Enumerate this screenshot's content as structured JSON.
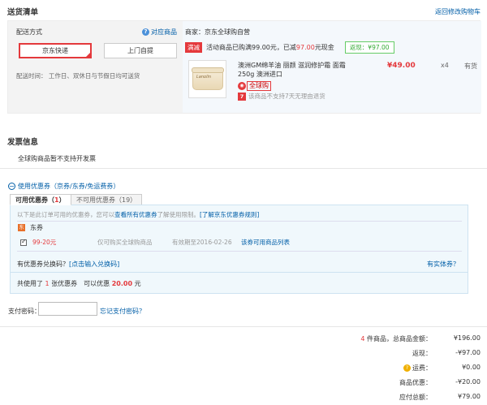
{
  "header": {
    "title": "送货清单",
    "back": "返回修改购物车"
  },
  "shipping": {
    "method_label": "配送方式",
    "match_goods": "对应商品",
    "options": [
      "京东快递",
      "上门自提"
    ],
    "time_label": "配送时间：",
    "time_value": "工作日、双休日与节假日均可送货"
  },
  "seller": {
    "name": "商家：京东全球购自营",
    "promo_tag": "满减",
    "promo_text_pre": "活动商品已购满99.00元，已减",
    "promo_amount": "97.00",
    "promo_text_post": "元现金",
    "rebate": "返现：¥97.00"
  },
  "product": {
    "image_text": "Lanolin",
    "name": "澳洲GM绵羊油 丽颜 滋润修护霜 面霜 250g 澳洲进口",
    "price": "¥49.00",
    "qty": "x4",
    "stock": "有货",
    "global_buy": "全球购",
    "no_return_icon": "7",
    "no_return": "该商品不支持7天无理由退货"
  },
  "invoice": {
    "title": "发票信息",
    "text": "全球购商品暂不支持开发票"
  },
  "coupon": {
    "toggle": "使用优惠券（京券/东券/免运费券）",
    "tab_available": "可用优惠券（",
    "tab_available_count": "1",
    "tab_available_close": "）",
    "tab_unavailable": "不可用优惠券（19）",
    "info_text": "以下是此订单可用的优惠券，您可以",
    "info_link1": "查看所有优惠券",
    "info_mid": "了解使用限制。",
    "info_link2": "[了解京东优惠券规则]",
    "group_icon": "东",
    "group": "东券",
    "item": {
      "amount": "99-20元",
      "scope": "仅可购买全球购商品",
      "expire": "有效期至2016-02-26",
      "list_link": "该券可用商品列表"
    },
    "redeem_text": "有优惠券兑换码？",
    "redeem_link": "[点击输入兑换码]",
    "physical": "有实体券？",
    "used_pre": "共使用了",
    "used_count": "1",
    "used_mid": "张优惠券　可以优惠",
    "used_amount": "20.00",
    "used_unit": "元"
  },
  "payment": {
    "label": "支付密码：",
    "forgot": "忘记支付密码？"
  },
  "summary": [
    {
      "count": "4",
      "label": "件商品，总商品金额：",
      "value": "¥196.00"
    },
    {
      "label": "返现：",
      "value": "-¥97.00"
    },
    {
      "label": "运费：",
      "value": "¥0.00",
      "icon": "?"
    },
    {
      "label": "商品优惠：",
      "value": "-¥20.00"
    },
    {
      "label": "应付总额：",
      "value": "¥79.00"
    }
  ]
}
